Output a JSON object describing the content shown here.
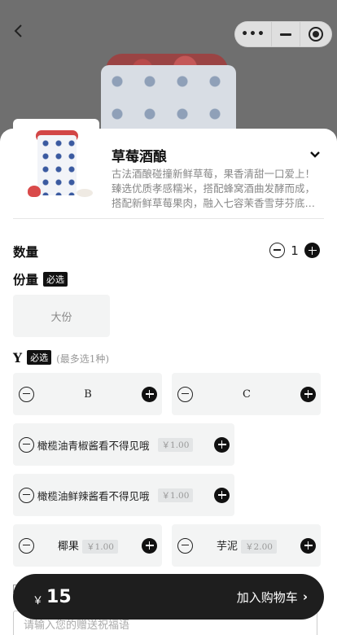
{
  "nav": {
    "back_icon": "chevron-left-icon",
    "more_icon": "more-dots-icon",
    "minimize_icon": "minimize-icon",
    "close_icon": "target-close-icon"
  },
  "product": {
    "name": "草莓酒酿",
    "description_lines": [
      "古法酒酿碰撞新鲜草莓，果香清甜一口爱上！",
      "臻选优质孝感糯米，搭配蜂窝酒曲发酵而成，",
      "搭配新鲜草莓果肉，融入七容茉香雪芽芬底…"
    ]
  },
  "quantity": {
    "label": "数量",
    "value": "1"
  },
  "portion": {
    "label": "份量",
    "required_badge": "必选",
    "options": [
      {
        "label": "大份"
      }
    ]
  },
  "addons": {
    "label": "Y",
    "required_badge": "必选",
    "hint": "(最多选1种)",
    "options": [
      {
        "label": "B",
        "price": ""
      },
      {
        "label": "C",
        "price": ""
      },
      {
        "label": "橄榄油青椒酱看不得见哦",
        "price": "￥1.00"
      },
      {
        "label": "橄榄油鲜辣酱看不得见哦",
        "price": "￥1.00"
      },
      {
        "label": "椰果",
        "price": "￥1.00"
      },
      {
        "label": "芋泥",
        "price": "￥2.00"
      }
    ]
  },
  "message": {
    "placeholder": "请输入您的赠送祝福语"
  },
  "cart": {
    "currency": "￥",
    "total": "15",
    "add_label": "加入购物车",
    "chevron": "›"
  },
  "colors": {
    "primary": "#111111",
    "cart_bg": "#1e1e1e",
    "option_bg": "#f3f4f4"
  }
}
